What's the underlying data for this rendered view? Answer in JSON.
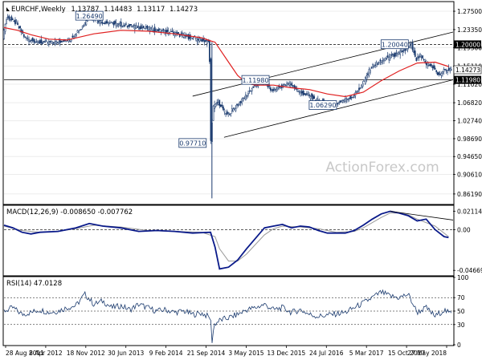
{
  "chart_data": [
    {
      "type": "candlestick",
      "panel": "price",
      "title": "EURCHF,Weekly",
      "ohlc_header": {
        "open": "1.13787",
        "high": "1.14483",
        "low": "1.13117",
        "close": "1.14273"
      },
      "ylim": [
        0.84,
        1.295
      ],
      "y_ticks": [
        0.8619,
        0.9061,
        0.9465,
        0.9869,
        1.0274,
        1.0682,
        1.1102,
        1.1511,
        1.193,
        1.2335,
        1.275
      ],
      "y_tick_labels": [
        "0.86190",
        "0.90610",
        "0.94650",
        "0.98690",
        "1.02740",
        "1.06820",
        "1.11020",
        "1.15110",
        "1.19300",
        "1.23350",
        "1.27500"
      ],
      "dates": [
        "28 Aug 2011",
        "8 Apr 2012",
        "18 Nov 2012",
        "30 Jun 2013",
        "9 Feb 2014",
        "21 Sep 2014",
        "3 May 2015",
        "13 Dec 2015",
        "24 Jul 2016",
        "5 Mar 2017",
        "15 Oct 2017",
        "27 May 2018"
      ],
      "price_path": [
        [
          0,
          1.215
        ],
        [
          0.5,
          1.245
        ],
        [
          1,
          1.262
        ],
        [
          3,
          1.247
        ],
        [
          5,
          1.215
        ],
        [
          8,
          1.204
        ],
        [
          12,
          1.205
        ],
        [
          15,
          1.212
        ],
        [
          18,
          1.244
        ],
        [
          19,
          1.263
        ],
        [
          22,
          1.25
        ],
        [
          26,
          1.245
        ],
        [
          30,
          1.24
        ],
        [
          34,
          1.233
        ],
        [
          38,
          1.225
        ],
        [
          42,
          1.215
        ],
        [
          45,
          1.208
        ],
        [
          46,
          1.205
        ],
        [
          46.3,
          0.975
        ],
        [
          46.8,
          1.058
        ],
        [
          48,
          1.068
        ],
        [
          50,
          1.04
        ],
        [
          52,
          1.06
        ],
        [
          54,
          1.082
        ],
        [
          56,
          1.106
        ],
        [
          58,
          1.118
        ],
        [
          60,
          1.095
        ],
        [
          62,
          1.105
        ],
        [
          64,
          1.112
        ],
        [
          66,
          1.092
        ],
        [
          68,
          1.085
        ],
        [
          70,
          1.072
        ],
        [
          72,
          1.068
        ],
        [
          74,
          1.065
        ],
        [
          76,
          1.075
        ],
        [
          78,
          1.082
        ],
        [
          80,
          1.108
        ],
        [
          82,
          1.148
        ],
        [
          84,
          1.16
        ],
        [
          86,
          1.172
        ],
        [
          88,
          1.178
        ],
        [
          90,
          1.19
        ],
        [
          91,
          1.198
        ],
        [
          92,
          1.163
        ],
        [
          93,
          1.175
        ],
        [
          94,
          1.158
        ],
        [
          96,
          1.148
        ],
        [
          97,
          1.128
        ],
        [
          98,
          1.14
        ],
        [
          99,
          1.143
        ]
      ],
      "ma_path": [
        [
          0,
          1.238
        ],
        [
          3,
          1.232
        ],
        [
          6,
          1.222
        ],
        [
          10,
          1.212
        ],
        [
          14,
          1.21
        ],
        [
          20,
          1.224
        ],
        [
          26,
          1.232
        ],
        [
          32,
          1.23
        ],
        [
          38,
          1.224
        ],
        [
          44,
          1.215
        ],
        [
          46,
          1.208
        ],
        [
          47,
          1.205
        ],
        [
          48,
          1.19
        ],
        [
          50,
          1.16
        ],
        [
          52,
          1.13
        ],
        [
          54,
          1.112
        ],
        [
          56,
          1.108
        ],
        [
          60,
          1.108
        ],
        [
          64,
          1.102
        ],
        [
          68,
          1.098
        ],
        [
          72,
          1.088
        ],
        [
          76,
          1.082
        ],
        [
          80,
          1.092
        ],
        [
          84,
          1.118
        ],
        [
          88,
          1.14
        ],
        [
          92,
          1.158
        ],
        [
          96,
          1.16
        ],
        [
          99,
          1.15
        ]
      ],
      "hlines": [
        {
          "label": "1.20000",
          "value": 1.2,
          "style": "dashed"
        },
        {
          "label": "1.11980",
          "value": 1.1198,
          "style": "solid"
        }
      ],
      "channel": {
        "upper": [
          [
            42,
            1.083
          ],
          [
            100,
            1.228
          ]
        ],
        "lower": [
          [
            49,
            0.99
          ],
          [
            100,
            1.12
          ]
        ]
      },
      "annotations": [
        {
          "label": "1.26490",
          "x": 19,
          "y": 1.2649
        },
        {
          "label": "1.11980",
          "x": 56,
          "y": 1.1198
        },
        {
          "label": "1.06290",
          "x": 71,
          "y": 1.0629
        },
        {
          "label": "1.20040",
          "x": 87,
          "y": 1.2004
        },
        {
          "label": "0.97710",
          "x": 42,
          "y": 0.9771
        }
      ],
      "current_value": {
        "label": "1.14273",
        "value": 1.14273
      },
      "watermark": "ActionForex.com"
    },
    {
      "type": "line",
      "panel": "macd",
      "title": "MACD(12,26,9) -0.008650 -0.007762",
      "ylim": [
        -0.052,
        0.027
      ],
      "y_ticks": [
        0.021146,
        0.0,
        -0.046699
      ],
      "y_tick_labels": [
        "0.021146",
        "0.00",
        "-0.046699"
      ],
      "macd_path": [
        [
          0,
          0.005
        ],
        [
          2,
          0.002
        ],
        [
          4,
          -0.003
        ],
        [
          6,
          -0.005
        ],
        [
          8,
          -0.003
        ],
        [
          12,
          -0.002
        ],
        [
          16,
          0.002
        ],
        [
          19,
          0.007
        ],
        [
          22,
          0.004
        ],
        [
          26,
          0.002
        ],
        [
          30,
          -0.002
        ],
        [
          34,
          -0.001
        ],
        [
          38,
          -0.002
        ],
        [
          42,
          -0.004
        ],
        [
          46,
          -0.003
        ],
        [
          47,
          -0.02
        ],
        [
          48,
          -0.045
        ],
        [
          50,
          -0.043
        ],
        [
          52,
          -0.035
        ],
        [
          54,
          -0.022
        ],
        [
          56,
          -0.01
        ],
        [
          58,
          0.002
        ],
        [
          60,
          0.004
        ],
        [
          62,
          0.006
        ],
        [
          64,
          0.002
        ],
        [
          66,
          0.004
        ],
        [
          68,
          0.003
        ],
        [
          70,
          -0.001
        ],
        [
          72,
          -0.004
        ],
        [
          74,
          -0.004
        ],
        [
          76,
          -0.004
        ],
        [
          78,
          -0.001
        ],
        [
          80,
          0.005
        ],
        [
          82,
          0.012
        ],
        [
          84,
          0.018
        ],
        [
          86,
          0.021
        ],
        [
          88,
          0.019
        ],
        [
          90,
          0.016
        ],
        [
          92,
          0.01
        ],
        [
          94,
          0.012
        ],
        [
          96,
          0.0
        ],
        [
          98,
          -0.008
        ],
        [
          99,
          -0.009
        ]
      ],
      "signal_path": [
        [
          0,
          0.004
        ],
        [
          4,
          -0.001
        ],
        [
          8,
          -0.003
        ],
        [
          12,
          -0.002
        ],
        [
          16,
          0.001
        ],
        [
          20,
          0.005
        ],
        [
          26,
          0.003
        ],
        [
          32,
          -0.001
        ],
        [
          38,
          -0.002
        ],
        [
          44,
          -0.003
        ],
        [
          47,
          -0.008
        ],
        [
          48,
          -0.022
        ],
        [
          50,
          -0.036
        ],
        [
          52,
          -0.036
        ],
        [
          54,
          -0.028
        ],
        [
          56,
          -0.017
        ],
        [
          58,
          -0.006
        ],
        [
          60,
          0.001
        ],
        [
          62,
          0.004
        ],
        [
          66,
          0.003
        ],
        [
          70,
          0.001
        ],
        [
          74,
          -0.003
        ],
        [
          78,
          -0.002
        ],
        [
          80,
          0.002
        ],
        [
          82,
          0.008
        ],
        [
          84,
          0.014
        ],
        [
          86,
          0.019
        ],
        [
          88,
          0.019
        ],
        [
          90,
          0.017
        ],
        [
          92,
          0.012
        ],
        [
          96,
          0.004
        ],
        [
          99,
          -0.008
        ]
      ],
      "trendline": [
        [
          86,
          0.021
        ],
        [
          100,
          0.011
        ]
      ]
    },
    {
      "type": "line",
      "panel": "rsi",
      "title": "RSI(14) 47.0128",
      "ylim": [
        0,
        100
      ],
      "y_ticks": [
        100,
        70,
        50,
        30,
        0
      ],
      "y_tick_labels": [
        "100",
        "70",
        "50",
        "30",
        "0"
      ],
      "rsi_path": [
        [
          0,
          50
        ],
        [
          2,
          55
        ],
        [
          4,
          45
        ],
        [
          6,
          48
        ],
        [
          8,
          52
        ],
        [
          10,
          48
        ],
        [
          12,
          50
        ],
        [
          14,
          55
        ],
        [
          16,
          58
        ],
        [
          18,
          75
        ],
        [
          19,
          68
        ],
        [
          20,
          60
        ],
        [
          22,
          65
        ],
        [
          24,
          55
        ],
        [
          26,
          58
        ],
        [
          28,
          52
        ],
        [
          30,
          60
        ],
        [
          32,
          55
        ],
        [
          34,
          50
        ],
        [
          36,
          52
        ],
        [
          38,
          48
        ],
        [
          40,
          50
        ],
        [
          42,
          45
        ],
        [
          44,
          47
        ],
        [
          46,
          40
        ],
        [
          46.3,
          4
        ],
        [
          46.8,
          30
        ],
        [
          48,
          36
        ],
        [
          50,
          40
        ],
        [
          52,
          45
        ],
        [
          54,
          52
        ],
        [
          56,
          55
        ],
        [
          58,
          60
        ],
        [
          60,
          52
        ],
        [
          62,
          55
        ],
        [
          64,
          48
        ],
        [
          66,
          52
        ],
        [
          68,
          45
        ],
        [
          70,
          42
        ],
        [
          72,
          44
        ],
        [
          74,
          46
        ],
        [
          76,
          48
        ],
        [
          78,
          55
        ],
        [
          80,
          62
        ],
        [
          82,
          70
        ],
        [
          84,
          78
        ],
        [
          86,
          72
        ],
        [
          88,
          70
        ],
        [
          90,
          75
        ],
        [
          92,
          48
        ],
        [
          94,
          55
        ],
        [
          96,
          42
        ],
        [
          98,
          52
        ],
        [
          99,
          47
        ]
      ]
    }
  ]
}
